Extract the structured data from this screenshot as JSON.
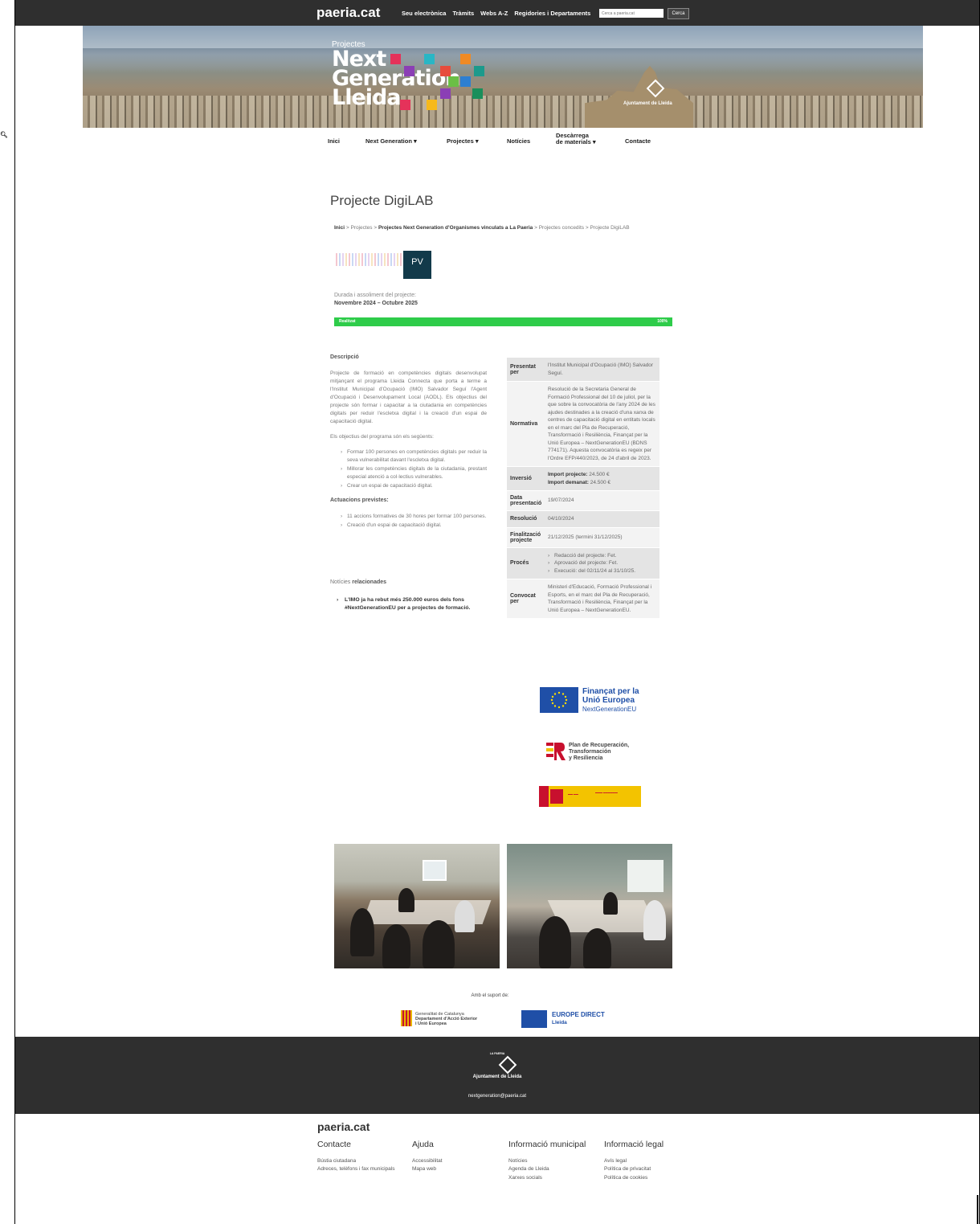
{
  "topbar": {
    "brand": "paeria.cat",
    "links": [
      "Seu electrònica",
      "Tràmits",
      "Webs A-Z",
      "Regidories i Departaments"
    ],
    "search_placeholder": "Cerca a paeria.cat",
    "search_button": "Cerca"
  },
  "banner": {
    "projectes": "Projectes",
    "logo_line1": "Next",
    "logo_line2": "Generation",
    "logo_line3": "Lleida",
    "ajuntament": "Ajuntament de Lleida"
  },
  "nav": {
    "inici": "Inici",
    "next_generation": "Next Generation",
    "projectes": "Projectes",
    "noticies": "Notícies",
    "descarrega_1": "Descàrrega",
    "descarrega_2": "de materials",
    "contacte": "Contacte"
  },
  "page": {
    "title": "Projecte DigiLAB",
    "breadcrumb": {
      "inici": "Inici",
      "projectes": "Projectes",
      "organismes": "Projectes Next Generation d'Organismes vinculats a La Paeria",
      "concedits": "Projectes concedits",
      "current": "Projecte DigiLAB"
    },
    "pv_label": "PV",
    "duracio_label": "Durada i assoliment del projecte:",
    "duracio_value": "Novembre 2024 – Octubre 2025",
    "progress": {
      "label": "Realitzat",
      "value_text": "100%",
      "percent": 100
    }
  },
  "descripcio": {
    "heading": "Descripció",
    "text": "Projecte de formació en competències digitals desenvolupat mitjançant el programa Lleida Connecta que porta a terme a l'Institut Municipal d'Ocupació (IMO) Salvador Seguí l'Agent d'Ocupació i Desenvolupament Local (AODL). Els objectius del projecte són formar i capacitar a la ciutadania en competències digitals per reduir l'escletxa digital i la creació d'un espai de capacitació digital.",
    "objectius_intro": "Els objectius del programa són els següents:",
    "objectius": [
      "Formar 100 persones en competències digitals per reduir la seva vulnerabilitat davant l'escletxa digital.",
      "Millorar les competències digitals de la ciutadania, prestant especial atenció a col·lectius vulnerables.",
      "Crear un espai de capacitació digital."
    ],
    "actuacions_heading": "Actuacions previstes:",
    "actuacions": [
      "11 accions formatives de 30 hores per formar 100 persones.",
      "Creació d'un espai de capacitació digital."
    ],
    "noticies_prefix": "Notícies ",
    "noticies_bold": "relacionades",
    "noticia": "L'IMO ja ha rebut més 250.000 euros dels fons #NextGenerationEU per a projectes de formació."
  },
  "info_table": {
    "presentat_k1": "Presentat",
    "presentat_k2": "per",
    "presentat_v": "l'Institut Municipal d'Ocupació (IMO) Salvador Seguí.",
    "normativa_k": "Normativa",
    "normativa_v": "Resolució de la Secretaria General de Formació Professional del 10 de juliol, per la que sobre la convocatòria de l'any 2024 de les ajudes destinades a la creació d'una xarxa de centres de capacitació digital en entitats locals en el marc del Pla de Recuperació, Transformació i Resiliència, Finançat per la Unió Europea – NextGenerationEU (BDNS 774171). Aquesta convocatòria es regeix per l'Ordre EFP/440/2023, de 24 d'abril de 2023.",
    "inversio_k": "Inversió",
    "import_projecte_label": "Import projecte:",
    "import_projecte": " 24.500 €",
    "import_demanat_label": "Import demanat:",
    "import_demanat": " 24.500 €",
    "data_k1": "Data",
    "data_k2": "presentació",
    "data_v": "19/07/2024",
    "resolucio_k": "Resolució",
    "resolucio_v": "04/10/2024",
    "final_k1": "Finalització",
    "final_k2": "projecte",
    "final_v": "21/12/2025 (termini 31/12/2025)",
    "proces_k": "Procés",
    "proces_v": [
      "Redacció del projecte: Fet.",
      "Aprovació del projecte: Fet.",
      "Execució: del 02/11/24 al 31/10/25."
    ],
    "convocat_k1": "Convocat",
    "convocat_k2": "per",
    "convocat_v": "Ministeri d'Educació, Formació Professional i Esports, en el marc del Pla de Recuperació, Transformació i Resiliència, Finançat per la Unió Europea – NextGenerationEU."
  },
  "logos": {
    "eu_1": "Finançat per la",
    "eu_2": "Unió Europea",
    "eu_3": "NextGenerationEU",
    "prtr_1": "Plan de Recuperación,",
    "prtr_2": "Transformación",
    "prtr_3": "y Resiliencia"
  },
  "support": {
    "amb": "Amb el suport de:",
    "gen_1": "Generalitat de Catalunya",
    "gen_2": "Departament d'Acció Exterior",
    "gen_3": "i Unió Europea",
    "ed_1": "EUROPE DIRECT",
    "ed_2": "Lleida"
  },
  "dark_footer": {
    "la_paeria": "LA PAERIA",
    "ajuntament": "Ajuntament de Lleida",
    "email": "nextgeneration@paeria.cat"
  },
  "footer": {
    "brand": "paeria.cat",
    "cols": [
      {
        "title": "Contacte",
        "items": [
          "Bústia ciutadana",
          "Adreces, telèfons i fax municipals"
        ]
      },
      {
        "title": "Ajuda",
        "items": [
          "Accessibilitat",
          "Mapa web"
        ]
      },
      {
        "title": "Informació municipal",
        "items": [
          "Notícies",
          "Agenda de Lleida",
          "Xarxes socials"
        ]
      },
      {
        "title": "Informació legal",
        "items": [
          "Avís legal",
          "Política de privacitat",
          "Política de cookies"
        ]
      }
    ]
  },
  "colors": {
    "topbar": "#2f2f2f",
    "progress": "#2ecc4a",
    "eu_blue": "#1f4fa7"
  }
}
